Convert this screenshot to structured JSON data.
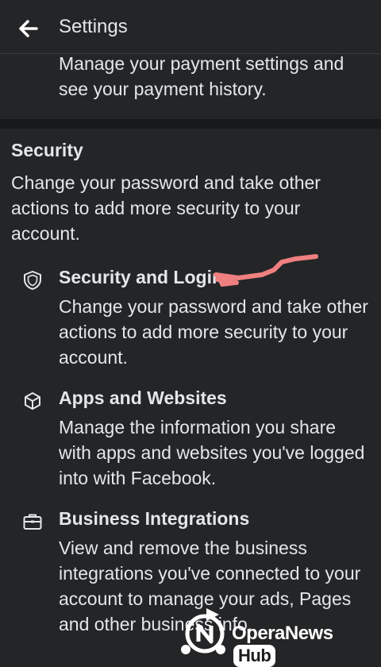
{
  "header": {
    "back_icon": "arrow-left-icon",
    "title": "Settings"
  },
  "payment": {
    "description": "Manage your payment settings and see your payment history."
  },
  "security": {
    "title": "Security",
    "description": "Change your password and take other actions to add more security to your account.",
    "items": [
      {
        "icon": "shield-icon",
        "title": "Security and Login",
        "description": "Change your password and take other actions to add more security to your account."
      },
      {
        "icon": "cube-icon",
        "title": "Apps and Websites",
        "description": "Manage the information you share with apps and websites you've logged into with Facebook."
      },
      {
        "icon": "briefcase-icon",
        "title": "Business Integrations",
        "description": "View and remove the business integrations you've connected to your account to manage your ads, Pages and other business info."
      }
    ]
  },
  "watermark": {
    "brand": "OperaNews",
    "hub": "Hub"
  },
  "colors": {
    "background": "#242526",
    "divider": "#18191a",
    "text": "#e4e6eb",
    "scribble": "#f08080"
  }
}
